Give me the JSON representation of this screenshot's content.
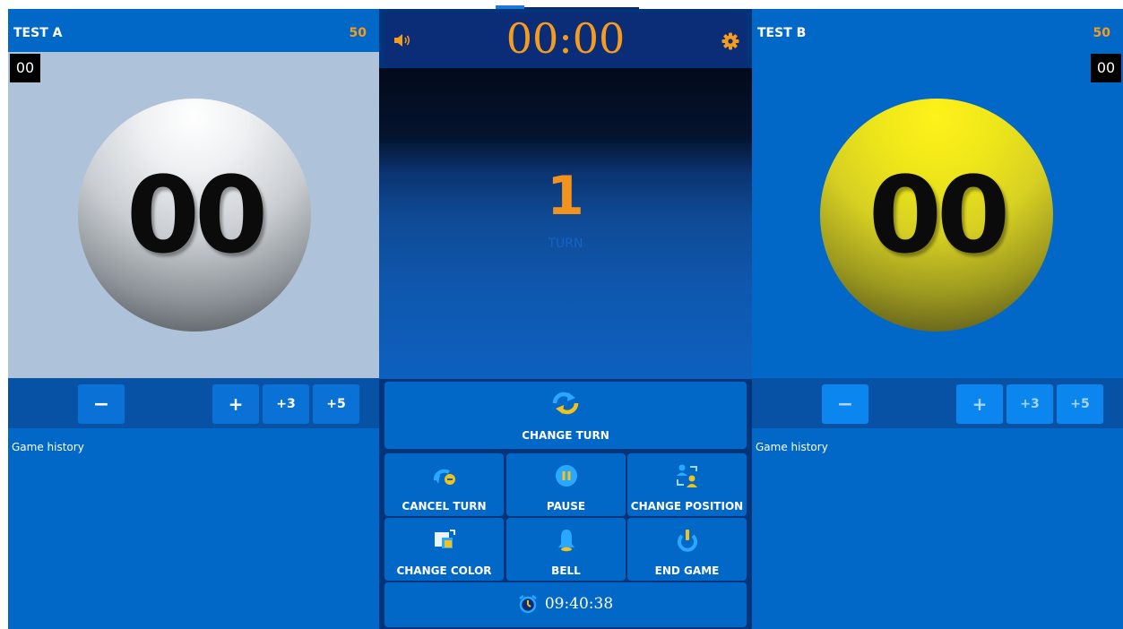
{
  "player_a": {
    "name": "TEST A",
    "score": "50",
    "mini_counter": "00",
    "ball_number": "00",
    "ball_color": "#d9dde1",
    "controls": {
      "minus": "−",
      "plus": "+",
      "plus3": "+3",
      "plus5": "+5"
    },
    "history_label": "Game history"
  },
  "player_b": {
    "name": "TEST B",
    "score": "50",
    "mini_counter": "00",
    "ball_number": "00",
    "ball_color": "#eee61a",
    "controls": {
      "minus": "−",
      "plus": "+",
      "plus3": "+3",
      "plus5": "+5"
    },
    "history_label": "Game history"
  },
  "center": {
    "timer": "00:00",
    "turn_number": "1",
    "turn_label": "TURN",
    "actions": {
      "change_turn": "CHANGE TURN",
      "cancel_turn": "CANCEL TURN",
      "pause": "PAUSE",
      "change_position": "CHANGE POSITION",
      "change_color": "CHANGE COLOR",
      "bell": "BELL",
      "end_game": "END GAME"
    },
    "clock": "09:40:38"
  },
  "icons": {
    "sound": "speaker-icon",
    "settings": "gear-icon",
    "change_turn": "swap-arrows-icon",
    "cancel_turn": "undo-icon",
    "pause": "pause-icon",
    "change_position": "swap-users-icon",
    "change_color": "color-swap-icon",
    "bell": "bell-icon",
    "end_game": "power-icon",
    "clock": "alarm-clock-icon"
  },
  "colors": {
    "accent_orange": "#f39c1e",
    "panel_blue": "#0168c8",
    "center_blue": "#02347a"
  }
}
